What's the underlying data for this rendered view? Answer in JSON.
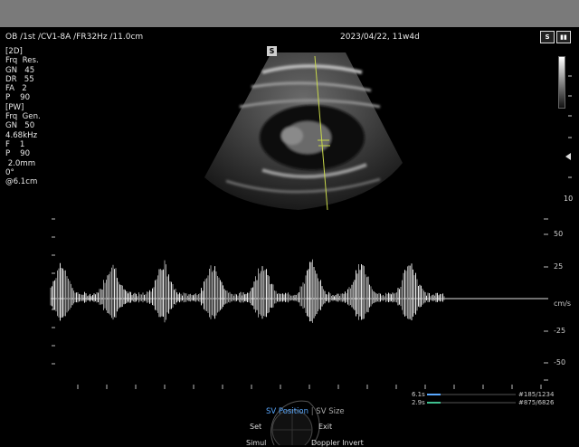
{
  "header": {
    "exam_info": "OB /1st /CV1-8A /FR32Hz /11.0cm",
    "date_ga": "2023/04/22, 11w4d"
  },
  "icons": [
    "battery-icon",
    "s-badge-icon"
  ],
  "probe_badge": "S",
  "params_2d": {
    "title": "[2D]",
    "rows": [
      "Frq  Res.",
      "GN   45",
      "DR   55",
      "FA   2",
      "P    90"
    ]
  },
  "params_pw": {
    "title": "[PW]",
    "rows": [
      "Frq  Gen.",
      "GN   50",
      "4.68kHz",
      "F    1",
      "P    90",
      " 2.0mm",
      "0°",
      "@6.1cm"
    ]
  },
  "depth_scale": {
    "bottom_label": "10"
  },
  "velocity_scale": {
    "labels": [
      "50",
      "25",
      "cm/s",
      "-25",
      "-50"
    ]
  },
  "sweep_info": {
    "row1_time": "6.1s",
    "row1_frame": "#185",
    "row1_total": "/1234",
    "row2_time": "2.9s",
    "row2_frame": "#875",
    "row2_total": "/6826"
  },
  "menu": {
    "selected": "SV Position",
    "separator": "|",
    "secondary": "SV Size",
    "left": "Set",
    "right": "Exit",
    "bottom_left": "Simul",
    "bottom_right": "Doppler Invert"
  },
  "colors": {
    "accent": "#5aa9ff",
    "cursor_line": "#c8d84a"
  }
}
